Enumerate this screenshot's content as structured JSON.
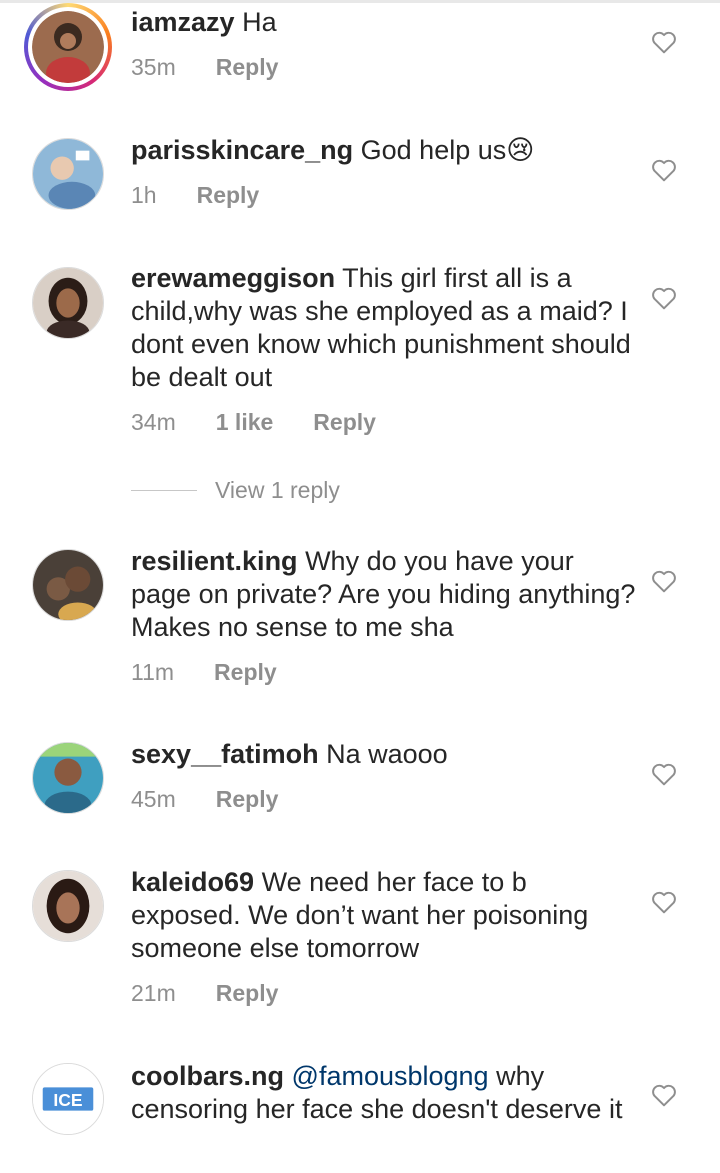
{
  "comments": [
    {
      "username": "iamzazy",
      "text": "Ha",
      "time": "35m",
      "reply": "Reply"
    },
    {
      "username": "parisskincare_ng",
      "text": "God help us😢",
      "time": "1h",
      "reply": "Reply"
    },
    {
      "username": "erewameggison",
      "text": "This girl first all is a child,why was she employed as a maid? I dont even know which punishment should be dealt out",
      "time": "34m",
      "likes": "1 like",
      "reply": "Reply"
    },
    {
      "username": "resilient.king",
      "text": "Why do you have your page on private? Are you hiding anything? Makes no sense to me sha",
      "time": "11m",
      "reply": "Reply"
    },
    {
      "username": "sexy__fatimoh",
      "text": "Na waooo",
      "time": "45m",
      "reply": "Reply"
    },
    {
      "username": "kaleido69",
      "text": "We need her face to b exposed. We don’t want her poisoning someone else tomorrow",
      "time": "21m",
      "reply": "Reply"
    },
    {
      "username": "coolbars.ng",
      "mention": "@famousblogng",
      "text": "why censoring her face she doesn't deserve it"
    }
  ],
  "view_replies": "View 1 reply",
  "icons": {
    "heart": "heart-outline-icon"
  },
  "colors": {
    "meta": "#8e8e8e",
    "mention": "#00376b",
    "text": "#262626"
  }
}
